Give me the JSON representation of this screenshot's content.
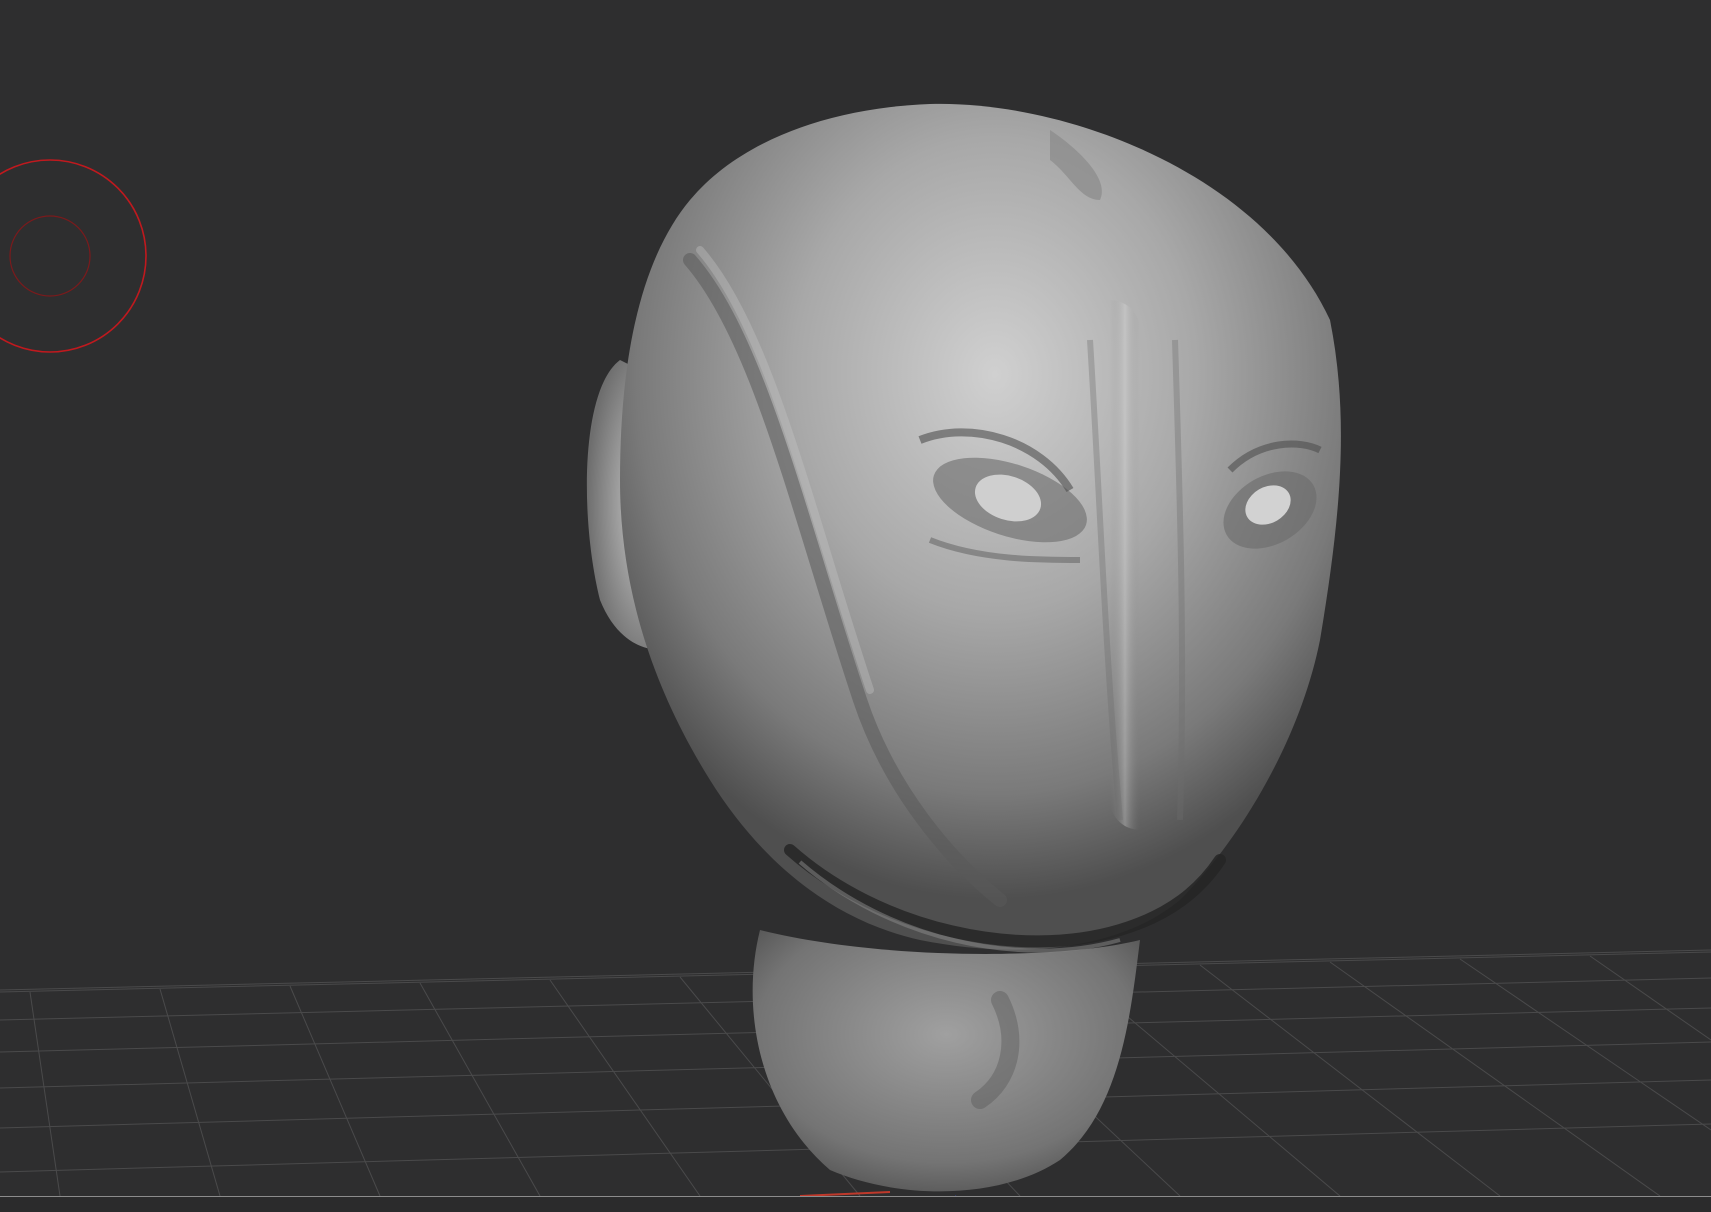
{
  "app": {
    "view": "3d-sculpt-viewport"
  },
  "viewport": {
    "background_color": "#2e2e2f",
    "grid_color": "#4a4a4b",
    "floor_grid_visible": true,
    "model": {
      "name_icon": "sculpted-alien-head",
      "base_color": "#a9a9a9",
      "highlight_color": "#d4d4d4",
      "shadow_color": "#4c4c4c"
    },
    "brush_cursor": {
      "icon": "brush-draw-size-icon",
      "color": "#c0191e"
    },
    "axis_indicator": {
      "x_color": "#c0392b",
      "z_color": "#3b4fc4"
    }
  }
}
